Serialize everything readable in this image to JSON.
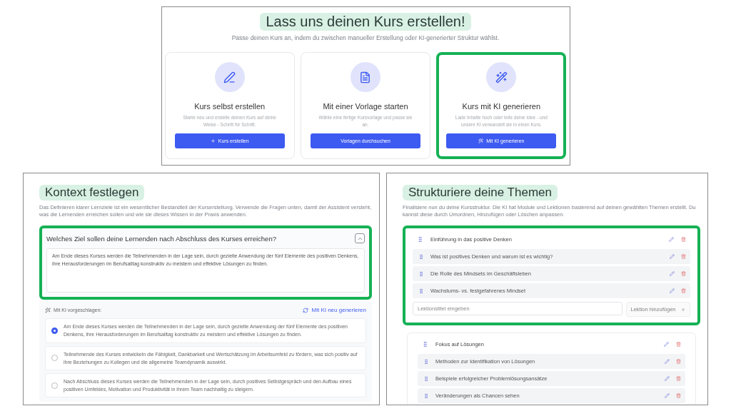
{
  "course_creation": {
    "title": "Lass uns deinen Kurs erstellen!",
    "subtitle": "Passe deinen Kurs an, indem du zwischen manueller Erstellung oder KI-generierter Struktur wählst.",
    "options": [
      {
        "title": "Kurs selbst erstellen",
        "description": "Starte neu und erstelle deinen Kurs auf deine Weise - Schritt für Schritt.",
        "button": "Kurs erstellen",
        "highlighted": false
      },
      {
        "title": "Mit einer Vorlage starten",
        "description": "Wähle eine fertige Kursvorlage und passe sie an.",
        "button": "Vorlagen durchsuchen",
        "highlighted": false
      },
      {
        "title": "Kurs mit KI generieren",
        "description": "Lade Inhalte hoch oder teile deine Idee - und unsere KI verwandelt sie in einen Kurs.",
        "button": "Mit KI generieren",
        "highlighted": true
      }
    ]
  },
  "context": {
    "title": "Kontext festlegen",
    "description": "Das Definieren klarer Lernziele ist ein wesentlicher Bestandteil der Kurserstellung. Verwende die Fragen unten, damit der Assistent versteht, was die Lernenden erreichen sollen und wie sie dieses Wissen in der Praxis anwenden.",
    "question": {
      "text": "Welches Ziel sollen deine Lernenden nach Abschluss des Kurses erreichen?",
      "answer": "Am Ende dieses Kurses werden die Teilnehmenden in der Lage sein, durch gezielte Anwendung der fünf Elemente des positiven Denkens, ihre Herausforderungen im Berufsalltag konstruktiv zu meistern und effektive Lösungen zu finden.",
      "expanded": true,
      "highlighted": true
    },
    "suggestions": {
      "label": "Mit KI vorgeschlagen:",
      "regenerate": "Mit KI neu generieren",
      "items": [
        {
          "text": "Am Ende dieses Kurses werden die Teilnehmenden in der Lage sein, durch gezielte Anwendung der fünf Elemente des positiven Denkens, ihre Herausforderungen im Berufsalltag konstruktiv zu meistern und effektive Lösungen zu finden.",
          "selected": true
        },
        {
          "text": "Teilnehmende des Kurses entwickeln die Fähigkeit, Dankbarkeit und Wertschätzung im Arbeitsumfeld zu fördern, was sich positiv auf ihre Beziehungen zu Kollegen und die allgemeine Teamdynamik auswirkt.",
          "selected": false
        },
        {
          "text": "Nach Abschluss dieses Kurses werden die Teilnehmenden in der Lage sein, durch positives Selbstgespräch und den Aufbau eines positiven Umfeldes, Motivation und Produktivität in ihrem Team nachhaltig zu steigern.",
          "selected": false
        }
      ]
    }
  },
  "structure": {
    "title": "Strukturiere deine Themen",
    "description": "Finalisiere nun du deine Kursstruktur. Die KI hat Module und Lektionen basierend auf deinen gewählten Themen erstellt. Du kannst diese durch Umordnen, Hinzufügen oder Löschen anpassen.",
    "modules": [
      {
        "title": "Einführung in das positive Denken",
        "highlighted": true,
        "lessons": [
          "Was ist positives Denken und warum ist es wichtig?",
          "Die Rolle des Mindsets im Geschäftsleben",
          "Wachstums- vs. festgefahrenes Mindset"
        ],
        "new_lesson": {
          "placeholder": "Lektionstitel eingeben",
          "button": "Lektion hinzufügen"
        }
      },
      {
        "title": "Fokus auf Lösungen",
        "highlighted": false,
        "lessons": [
          "Methoden zur Identifikation von Lösungen",
          "Beispiele erfolgreicher Problemlösungsansätze",
          "Veränderungen als Chancen sehen"
        ]
      }
    ]
  }
}
